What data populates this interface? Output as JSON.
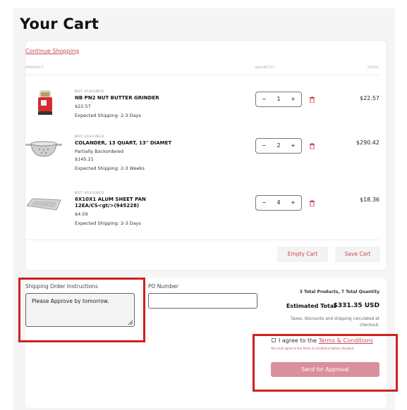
{
  "page": {
    "title": "Your Cart"
  },
  "cart": {
    "continue_label": "Continue Shopping",
    "columns": {
      "product": "PRODUCT",
      "quantity": "QUANTITY",
      "total": "TOTAL"
    },
    "items": [
      {
        "tag": "NOT ASSIGNED",
        "name": "NB PN2 NUT BUTTER GRINDER",
        "lines": [
          "$22.57"
        ],
        "shipping": "Expected Shipping: 2-3 Days",
        "quantity": "1",
        "total": "$22.57"
      },
      {
        "tag": "NOT ASSIGNED",
        "name": "COLANDER, 13 QUART, 13\" DIAMET",
        "lines": [
          "Partially Backordered",
          "$145.21"
        ],
        "shipping": "Expected Shipping: 2-3 Weeks",
        "quantity": "2",
        "total": "$290.42"
      },
      {
        "tag": "NOT ASSIGNED",
        "name": "6X10X1 ALUM SHEET PAN 12EA/CS<gt/>(945228)",
        "lines": [
          "$4.59"
        ],
        "shipping": "Expected Shipping: 2-3 Days",
        "quantity": "4",
        "total": "$18.36"
      }
    ],
    "qty_minus": "−",
    "qty_plus": "+",
    "empty_label": "Empty Cart",
    "save_label": "Save Cart"
  },
  "order": {
    "instructions_label": "Shipping Order Instructions",
    "instructions_value": "Please Approve by tomorrow.",
    "po_label": "PO Number",
    "po_value": "",
    "summary_counts": "3 Total Products, 7 Total Quantity",
    "estimated_label": "Estimated Total",
    "estimated_value": "$331.35 USD",
    "tax_note": "Taxes, discounts and shipping calculated at checkout.",
    "agree_prefix": "I agree to the ",
    "agree_link": "Terms & Conditions",
    "agree_note": "You must agree to the Terms & Conditions before checkout.",
    "send_label": "Send for Approval"
  },
  "colors": {
    "accent": "#c8464f",
    "send_button": "#d9909a",
    "highlight_box": "#d21f1f"
  },
  "icons": {
    "delete": "trash-icon",
    "resize": "resize-grip-icon"
  }
}
